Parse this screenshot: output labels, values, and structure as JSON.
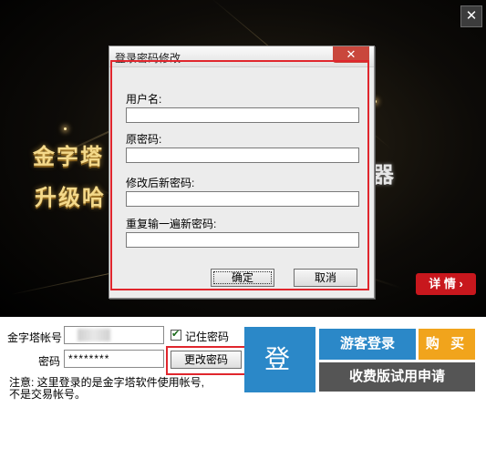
{
  "banner": {
    "headline_line1": "金字塔",
    "headline_line2": "升级哈",
    "headline_tail": "器",
    "detail_button": "详 情 ›",
    "close_glyph": "✕"
  },
  "dialog": {
    "title": "登录密码修改",
    "close_glyph": "✕",
    "fields": [
      {
        "label": "用户名:",
        "value": ""
      },
      {
        "label": "原密码:",
        "value": ""
      },
      {
        "label": "修改后新密码:",
        "value": ""
      },
      {
        "label": "重复输一遍新密码:",
        "value": ""
      }
    ],
    "ok_label": "确定",
    "cancel_label": "取消"
  },
  "login": {
    "account_label": "金字塔帐号",
    "account_value": "",
    "password_label": "密码",
    "password_value": "********",
    "remember_label": "记住密码",
    "remember_checked": true,
    "change_password_label": "更改密码",
    "login_label": "登 陆",
    "guest_label": "游客登录",
    "buy_label": "购 买",
    "trial_label": "收费版试用申请",
    "note_line1": "注意: 这里登录的是金字塔软件使用帐号,",
    "note_line2": "不是交易帐号。"
  },
  "colors": {
    "accent_blue": "#2b88c8",
    "buy_orange": "#f1a41c",
    "detail_red": "#c8171d",
    "highlight_red": "#e0262d"
  }
}
